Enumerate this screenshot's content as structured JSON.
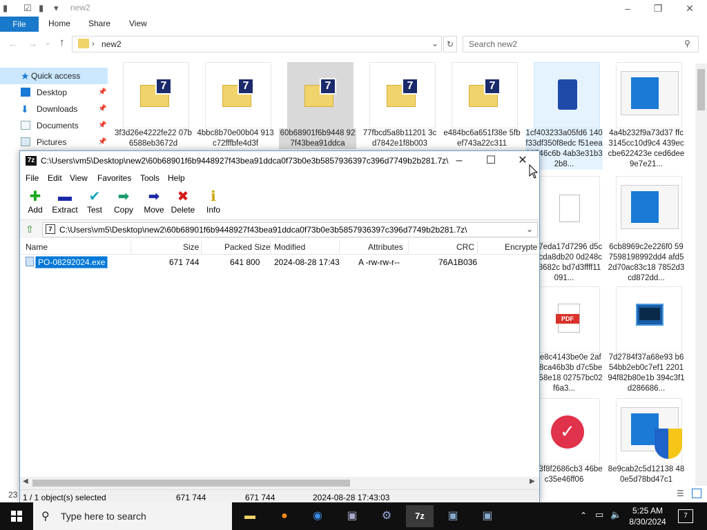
{
  "explorer": {
    "title": "new2",
    "tabs": {
      "file": "File",
      "home": "Home",
      "share": "Share",
      "view": "View"
    },
    "address": "new2",
    "search_placeholder": "Search new2",
    "nav": [
      {
        "label": "Quick access"
      },
      {
        "label": "Desktop"
      },
      {
        "label": "Downloads"
      },
      {
        "label": "Documents"
      },
      {
        "label": "Pictures"
      }
    ],
    "tiles": [
      {
        "name": "3f3d26e4222fe22 07b6588eb3672d",
        "icon": "7zip-archive-icon"
      },
      {
        "name": "4bbc8b70e00b04 913c72fffbfe4d3f",
        "icon": "7zip-archive-icon"
      },
      {
        "name": "60b68901f6b9448 927f43bea91ddca",
        "icon": "7zip-archive-icon"
      },
      {
        "name": "77fbcd5a8b11201 3cd7842e1f8b003",
        "icon": "7zip-archive-icon"
      },
      {
        "name": "e484bc6a651f38e 5fbef743a22c311",
        "icon": "7zip-archive-icon"
      },
      {
        "name": "1cf403233a05fd6 140f33df350f8edc f51eea02746c6b 4ab3e31b32b8...",
        "icon": "blue-box-icon"
      },
      {
        "name": "4a4b232f9a73d37 ffc3145cc10d9c4 439eccbe622423e ced6dee9e7e21...",
        "icon": "window-app-icon"
      },
      {
        "name": "c6e7eda17d7296 d5c0c0cda8db20 0d248c14f8682c bd7d3ffff11091...",
        "icon": "blank-file-icon"
      },
      {
        "name": "6cb8969c2e226f0 597598198992dd4 afd52d70ac83c18 7852d3cd872dd...",
        "icon": "window-app-icon"
      },
      {
        "name": "c86e8c4143be0e 2af9558ca46b3b d7c5bee5e58e18 02757bc02f6a3...",
        "icon": "pdf-file-icon"
      },
      {
        "name": "7d2784f37a68e93 b654bb2eb0c7ef1 220194f82b80e1b 394c3f1d286686...",
        "icon": "terminal-app-icon"
      },
      {
        "name": "dd53f8f2686cb3 46bec35e46ff06",
        "icon": "red-check-icon"
      },
      {
        "name": "8e9cab2c5d12138 480e5d78bd47c1",
        "icon": "shield-app-icon"
      }
    ],
    "status_left": "23"
  },
  "zip": {
    "title": "C:\\Users\\vm5\\Desktop\\new2\\60b68901f6b9448927f43bea91ddca0f73b0e3b5857936397c396d7749b2b281.7z\\",
    "menu": [
      "File",
      "Edit",
      "View",
      "Favorites",
      "Tools",
      "Help"
    ],
    "toolbar": [
      {
        "label": "Add",
        "icon": "add-icon"
      },
      {
        "label": "Extract",
        "icon": "extract-icon"
      },
      {
        "label": "Test",
        "icon": "test-icon"
      },
      {
        "label": "Copy",
        "icon": "copy-icon"
      },
      {
        "label": "Move",
        "icon": "move-icon"
      },
      {
        "label": "Delete",
        "icon": "delete-icon"
      },
      {
        "label": "Info",
        "icon": "info-icon"
      }
    ],
    "address": "C:\\Users\\vm5\\Desktop\\new2\\60b68901f6b9448927f43bea91ddca0f73b0e3b5857936397c396d7749b2b281.7z\\",
    "columns": [
      "Name",
      "Size",
      "Packed Size",
      "Modified",
      "Attributes",
      "CRC",
      "Encrypte"
    ],
    "rows": [
      {
        "name": "PO-08292024.exe",
        "size": "671 744",
        "packed": "641 800",
        "modified": "2024-08-28 17:43",
        "attributes": "A -rw-rw-r--",
        "crc": "76A1B036"
      }
    ],
    "status": {
      "selected": "1 / 1 object(s) selected",
      "size": "671 744",
      "packed": "671 744",
      "date": "2024-08-28 17:43:03"
    }
  },
  "taskbar": {
    "search_placeholder": "Type here to search",
    "time": "5:25 AM",
    "date": "8/30/2024",
    "notification_count": "7"
  }
}
